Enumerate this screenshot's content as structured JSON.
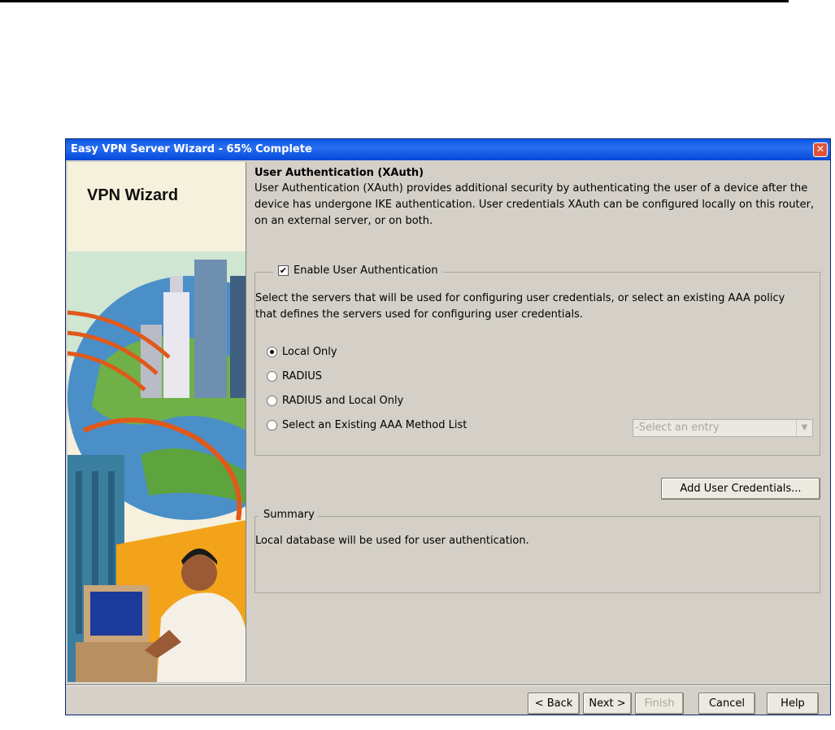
{
  "window": {
    "title": "Easy VPN Server Wizard - 65% Complete"
  },
  "side": {
    "title": "VPN Wizard"
  },
  "section": {
    "title": "User Authentication (XAuth)",
    "description": "User Authentication (XAuth) provides additional security by authenticating the user of a device after the device has undergone IKE authentication. User credentials XAuth can be configured locally on this router, on an external server, or on both."
  },
  "auth": {
    "enable_label": "Enable User Authentication",
    "enable_checked": true,
    "description": "Select the servers that will be used for configuring user credentials, or select an existing AAA policy that defines the servers used for configuring user credentials.",
    "options": [
      {
        "label": "Local Only",
        "checked": true
      },
      {
        "label": "RADIUS",
        "checked": false
      },
      {
        "label": "RADIUS and Local Only",
        "checked": false
      },
      {
        "label": "Select an Existing AAA Method List",
        "checked": false
      }
    ],
    "method_list_placeholder": "-Select an entry"
  },
  "add_credentials_label": "Add User Credentials...",
  "summary": {
    "legend": "Summary",
    "text": "Local database will be used for user authentication."
  },
  "footer": {
    "back": "< Back",
    "next": "Next >",
    "finish": "Finish",
    "cancel": "Cancel",
    "help": "Help"
  }
}
